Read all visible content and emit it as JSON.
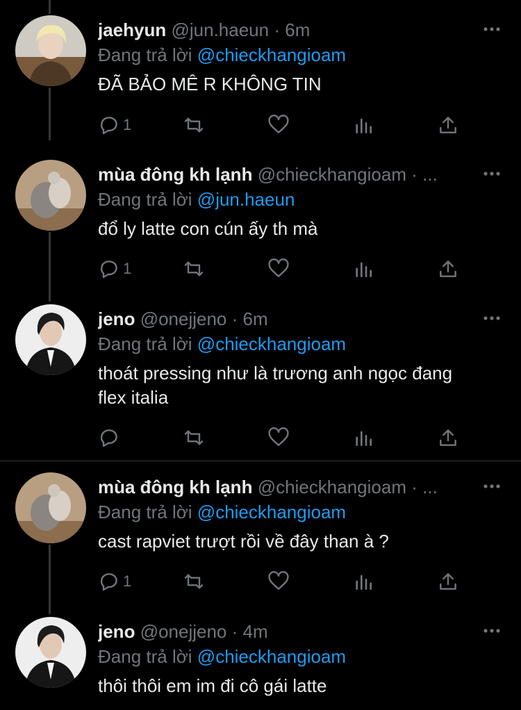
{
  "reply_prefix": "Đang trả lời",
  "tweets": [
    {
      "name": "jaehyun",
      "handle": "@jun.haeun",
      "dot": "·",
      "time": "6m",
      "reply_to": "@chieckhangioam",
      "text": "ĐÃ BẢO MÊ R KHÔNG TIN",
      "reply_count": "1",
      "avatar": "blond-person-avatar"
    },
    {
      "name": "mùa đông kh lạnh",
      "handle": "@chieckhangioam",
      "dot": "·",
      "time": "...",
      "reply_to": "@jun.haeun",
      "text": "đổ ly latte con cún ấy th mà",
      "reply_count": "1",
      "avatar": "cat-avatar"
    },
    {
      "name": "jeno",
      "handle": "@onejjeno",
      "dot": "·",
      "time": "6m",
      "reply_to": "@chieckhangioam",
      "text": "thoát pressing như là trương anh ngọc đang\nflex italia",
      "reply_count": "",
      "avatar": "dark-hair-person-avatar"
    },
    {
      "name": "mùa đông kh lạnh",
      "handle": "@chieckhangioam",
      "dot": "·",
      "time": "...",
      "reply_to": "@chieckhangioam",
      "text": "cast rapviet trượt rồi về đây than à ?",
      "reply_count": "1",
      "avatar": "cat-avatar"
    },
    {
      "name": "jeno",
      "handle": "@onejjeno",
      "dot": "·",
      "time": "4m",
      "reply_to": "@chieckhangioam",
      "text": "thôi thôi em im đi cô gái latte",
      "reply_count": "",
      "avatar": "dark-hair-person-avatar"
    }
  ],
  "colors": {
    "background": "#000000",
    "text": "#e7e9ea",
    "muted": "#71767b",
    "mention": "#1d9bf0",
    "thread_line": "#333639"
  }
}
